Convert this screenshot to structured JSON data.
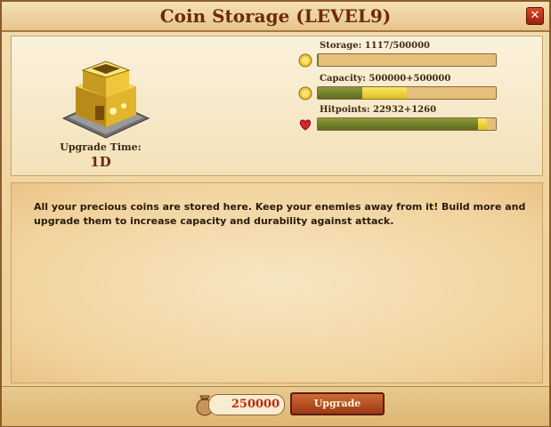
{
  "window": {
    "title": "Coin Storage (LEVEL9)",
    "close_label": "✕"
  },
  "building": {
    "icon": "gold-coin-storage-building",
    "upgrade_time_label": "Upgrade Time:",
    "upgrade_time_value": "1D"
  },
  "stats": {
    "storage": {
      "label": "Storage: 1117/500000",
      "icon": "coin-icon",
      "fraction": 0.002
    },
    "capacity": {
      "label": "Capacity: 500000+500000",
      "icon": "coin-icon",
      "current_fraction": 0.25,
      "bonus_fraction": 0.25
    },
    "hitpoints": {
      "label": "Hitpoints: 22932+1260",
      "icon": "heart-icon",
      "current_fraction": 0.9,
      "bonus_fraction": 0.05
    }
  },
  "description": "All your precious coins are stored here. Keep your enemies away from it! Build more and upgrade them to increase capacity and durability against attack.",
  "footer": {
    "cost_value": "250000",
    "cost_icon": "coin-bag-icon",
    "upgrade_label": "Upgrade"
  },
  "colors": {
    "title": "#6b2a0e",
    "cost": "#c1270c",
    "bar_fill": "#6f7b2a",
    "bar_bonus": "#f2d53a"
  }
}
